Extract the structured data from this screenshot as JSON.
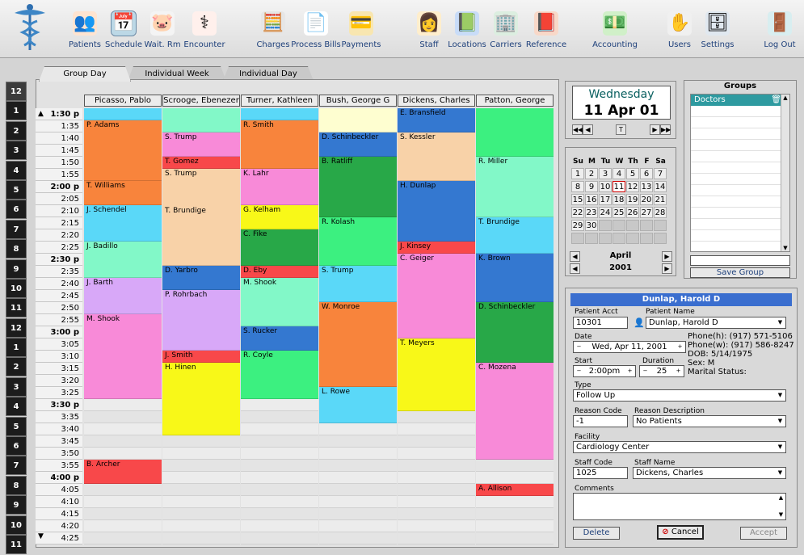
{
  "toolbar": {
    "items": [
      {
        "label": "Patients",
        "icon": "patients-icon"
      },
      {
        "label": "Schedule",
        "icon": "schedule-icon"
      },
      {
        "label": "Wait. Rm",
        "icon": "waiting-room-icon"
      },
      {
        "label": "Encounter",
        "icon": "encounter-icon"
      },
      {
        "label": "Charges",
        "icon": "charges-icon"
      },
      {
        "label": "Process Bills",
        "icon": "process-bills-icon"
      },
      {
        "label": "Payments",
        "icon": "payments-icon"
      },
      {
        "label": "Staff",
        "icon": "staff-icon"
      },
      {
        "label": "Locations",
        "icon": "locations-icon"
      },
      {
        "label": "Carriers",
        "icon": "carriers-icon"
      },
      {
        "label": "Reference",
        "icon": "reference-icon"
      },
      {
        "label": "Accounting",
        "icon": "accounting-icon"
      },
      {
        "label": "Users",
        "icon": "users-icon"
      },
      {
        "label": "Settings",
        "icon": "settings-icon"
      },
      {
        "label": "Log Out",
        "icon": "logout-icon"
      }
    ]
  },
  "tabs": [
    {
      "label": "Group Day",
      "active": true
    },
    {
      "label": "Individual Week",
      "active": false
    },
    {
      "label": "Individual Day",
      "active": false
    }
  ],
  "hour_strip": [
    "12",
    "1",
    "2",
    "3",
    "4",
    "5",
    "6",
    "7",
    "8",
    "9",
    "10",
    "11",
    "12",
    "1",
    "2",
    "3",
    "4",
    "5",
    "6",
    "7",
    "8",
    "9",
    "10",
    "11"
  ],
  "times": [
    "1:30 p",
    "1:35",
    "1:40",
    "1:45",
    "1:50",
    "1:55",
    "2:00 p",
    "2:05",
    "2:10",
    "2:15",
    "2:20",
    "2:25",
    "2:30 p",
    "2:35",
    "2:40",
    "2:45",
    "2:50",
    "2:55",
    "3:00 p",
    "3:05",
    "3:10",
    "3:15",
    "3:20",
    "3:25",
    "3:30 p",
    "3:35",
    "3:40",
    "3:45",
    "3:50",
    "3:55",
    "4:00 p",
    "4:05",
    "4:10",
    "4:15",
    "4:20",
    "4:25"
  ],
  "columns": [
    {
      "name": "Picasso, Pablo",
      "appointments": [
        {
          "start": 0,
          "len": 1,
          "label": "",
          "color": "#5ad8f8"
        },
        {
          "start": 1,
          "len": 5,
          "label": "P. Adams",
          "color": "#f8843c"
        },
        {
          "start": 6,
          "len": 2,
          "label": "T. Williams",
          "color": "#f8843c"
        },
        {
          "start": 8,
          "len": 3,
          "label": "J. Schendel",
          "color": "#5ad8f8"
        },
        {
          "start": 11,
          "len": 3,
          "label": "J. Badillo",
          "color": "#82f8c8"
        },
        {
          "start": 14,
          "len": 3,
          "label": "J. Barth",
          "color": "#d8a8f8"
        },
        {
          "start": 17,
          "len": 7,
          "label": "M. Shook",
          "color": "#f88ad8"
        },
        {
          "start": 29,
          "len": 2,
          "label": "B. Archer",
          "color": "#f8484a"
        }
      ]
    },
    {
      "name": "Scrooge, Ebenezer",
      "appointments": [
        {
          "start": 0,
          "len": 2,
          "label": "",
          "color": "#82f8c8"
        },
        {
          "start": 2,
          "len": 2,
          "label": "S. Trump",
          "color": "#f88ad8"
        },
        {
          "start": 4,
          "len": 1,
          "label": "T. Gomez",
          "color": "#f8484a"
        },
        {
          "start": 5,
          "len": 8,
          "label": "S. Trump",
          "color": "#f8d2a8"
        },
        {
          "start": 8,
          "len": 0,
          "label": "T. Brundige",
          "color": "#f8d2a8"
        },
        {
          "start": 13,
          "len": 2,
          "label": "D. Yarbro",
          "color": "#3478d0"
        },
        {
          "start": 15,
          "len": 5,
          "label": "P. Rohrbach",
          "color": "#d8a8f8"
        },
        {
          "start": 20,
          "len": 1,
          "label": "J. Smith",
          "color": "#f8484a"
        },
        {
          "start": 21,
          "len": 6,
          "label": "H. Hinen",
          "color": "#f8f818"
        }
      ]
    },
    {
      "name": "Turner, Kathleen",
      "appointments": [
        {
          "start": 0,
          "len": 1,
          "label": "",
          "color": "#5ad8f8"
        },
        {
          "start": 1,
          "len": 4,
          "label": "R. Smith",
          "color": "#f8843c"
        },
        {
          "start": 5,
          "len": 3,
          "label": "K. Lahr",
          "color": "#f88ad8"
        },
        {
          "start": 8,
          "len": 2,
          "label": "G. Kelham",
          "color": "#f8f818"
        },
        {
          "start": 10,
          "len": 3,
          "label": "C. Fike",
          "color": "#28a848"
        },
        {
          "start": 13,
          "len": 1,
          "label": "D. Eby",
          "color": "#f8484a"
        },
        {
          "start": 14,
          "len": 4,
          "label": "M. Shook",
          "color": "#82f8c8"
        },
        {
          "start": 18,
          "len": 2,
          "label": "S. Rucker",
          "color": "#3478d0"
        },
        {
          "start": 20,
          "len": 4,
          "label": "R. Coyle",
          "color": "#3cf080"
        }
      ]
    },
    {
      "name": "Bush, George G",
      "appointments": [
        {
          "start": 0,
          "len": 2,
          "label": "",
          "color": "#fefed0"
        },
        {
          "start": 2,
          "len": 2,
          "label": "D. Schinbeckler",
          "color": "#3478d0"
        },
        {
          "start": 4,
          "len": 5,
          "label": "B. Ratliff",
          "color": "#28a848"
        },
        {
          "start": 9,
          "len": 4,
          "label": "R. Kolash",
          "color": "#3cf080"
        },
        {
          "start": 13,
          "len": 3,
          "label": "S. Trump",
          "color": "#5ad8f8"
        },
        {
          "start": 16,
          "len": 7,
          "label": "W. Monroe",
          "color": "#f8843c"
        },
        {
          "start": 23,
          "len": 3,
          "label": "L. Rowe",
          "color": "#5ad8f8"
        }
      ]
    },
    {
      "name": "Dickens, Charles",
      "appointments": [
        {
          "start": 0,
          "len": 2,
          "label": "E. Bransfield",
          "color": "#3478d0"
        },
        {
          "start": 2,
          "len": 4,
          "label": "S. Kessler",
          "color": "#f8d2a8"
        },
        {
          "start": 6,
          "len": 5,
          "label": "H. Dunlap",
          "color": "#3478d0"
        },
        {
          "start": 11,
          "len": 1,
          "label": "J. Kinsey",
          "color": "#f8484a"
        },
        {
          "start": 12,
          "len": 7,
          "label": "C. Geiger",
          "color": "#f88ad8"
        },
        {
          "start": 19,
          "len": 6,
          "label": "T. Meyers",
          "color": "#f8f818"
        }
      ]
    },
    {
      "name": "Patton, George",
      "appointments": [
        {
          "start": 0,
          "len": 4,
          "label": "",
          "color": "#3cf080"
        },
        {
          "start": 4,
          "len": 5,
          "label": "R. Miller",
          "color": "#82f8c8"
        },
        {
          "start": 9,
          "len": 3,
          "label": "T. Brundige",
          "color": "#5ad8f8"
        },
        {
          "start": 12,
          "len": 4,
          "label": "K. Brown",
          "color": "#3478d0"
        },
        {
          "start": 16,
          "len": 5,
          "label": "D. Schinbeckler",
          "color": "#28a848"
        },
        {
          "start": 21,
          "len": 8,
          "label": "C. Mozena",
          "color": "#f88ad8"
        },
        {
          "start": 31,
          "len": 1,
          "label": "A. Allison",
          "color": "#f8484a"
        }
      ]
    }
  ],
  "date": {
    "weekday": "Wednesday",
    "date": "11 Apr 01",
    "today_btn": "T"
  },
  "calendar": {
    "weekdays": [
      "Su",
      "M",
      "Tu",
      "W",
      "Th",
      "F",
      "Sa"
    ],
    "lead_blanks": 0,
    "days": 30,
    "today": 11,
    "month": "April",
    "year": "2001"
  },
  "groups": {
    "title": "Groups",
    "items": [
      "Doctors"
    ],
    "save_label": "Save Group",
    "name_value": ""
  },
  "detail": {
    "title": "Dunlap, Harold D",
    "patient_acct_label": "Patient Acct",
    "patient_acct": "10301",
    "patient_name_label": "Patient Name",
    "patient_name": "Dunlap, Harold D",
    "date_label": "Date",
    "date_value": "Wed, Apr 11, 2001",
    "phone_h": "Phone(h):  (917) 571-5106",
    "phone_w": "Phone(w):  (917) 586-8247",
    "dob": "DOB:  5/14/1975",
    "sex": "Sex:  M",
    "marital": "Marital Status:",
    "start_label": "Start",
    "start_value": "2:00pm",
    "duration_label": "Duration",
    "duration_value": "25",
    "type_label": "Type",
    "type_value": "Follow Up",
    "reason_code_label": "Reason Code",
    "reason_code": "-1",
    "reason_desc_label": "Reason Description",
    "reason_desc": "No Patients",
    "facility_label": "Facility",
    "facility": "Cardiology Center",
    "staff_code_label": "Staff Code",
    "staff_code": "1025",
    "staff_name_label": "Staff Name",
    "staff_name": "Dickens, Charles",
    "comments_label": "Comments",
    "comments": "",
    "delete_label": "Delete",
    "cancel_label": "Cancel",
    "accept_label": "Accept"
  }
}
